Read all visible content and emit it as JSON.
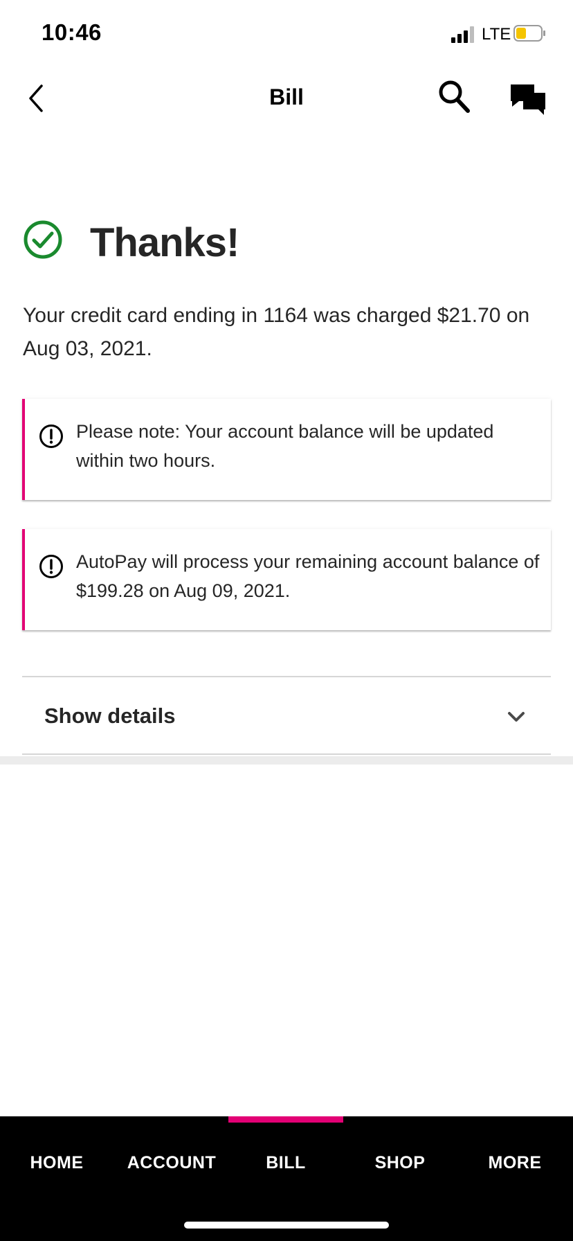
{
  "status_bar": {
    "time": "10:46",
    "network": "LTE"
  },
  "header": {
    "title": "Bill"
  },
  "confirmation": {
    "title": "Thanks!",
    "message": "Your credit card ending in 1164 was charged $21.70 on Aug 03, 2021."
  },
  "notices": [
    {
      "text": "Please note: Your account balance will be updated within two hours."
    },
    {
      "text": "AutoPay will process your remaining account balance of $199.28 on Aug 09, 2021."
    }
  ],
  "details": {
    "label": "Show details"
  },
  "tabs": [
    {
      "label": "HOME"
    },
    {
      "label": "ACCOUNT"
    },
    {
      "label": "BILL"
    },
    {
      "label": "SHOP"
    },
    {
      "label": "MORE"
    }
  ],
  "active_tab": "BILL",
  "colors": {
    "accent": "#e20074",
    "success": "#1a8a2e",
    "battery_level": "#f5c400"
  },
  "icons": [
    "back-arrow-icon",
    "search-icon",
    "chat-icon",
    "check-circle-icon",
    "alert-circle-icon",
    "chevron-down-icon"
  ]
}
